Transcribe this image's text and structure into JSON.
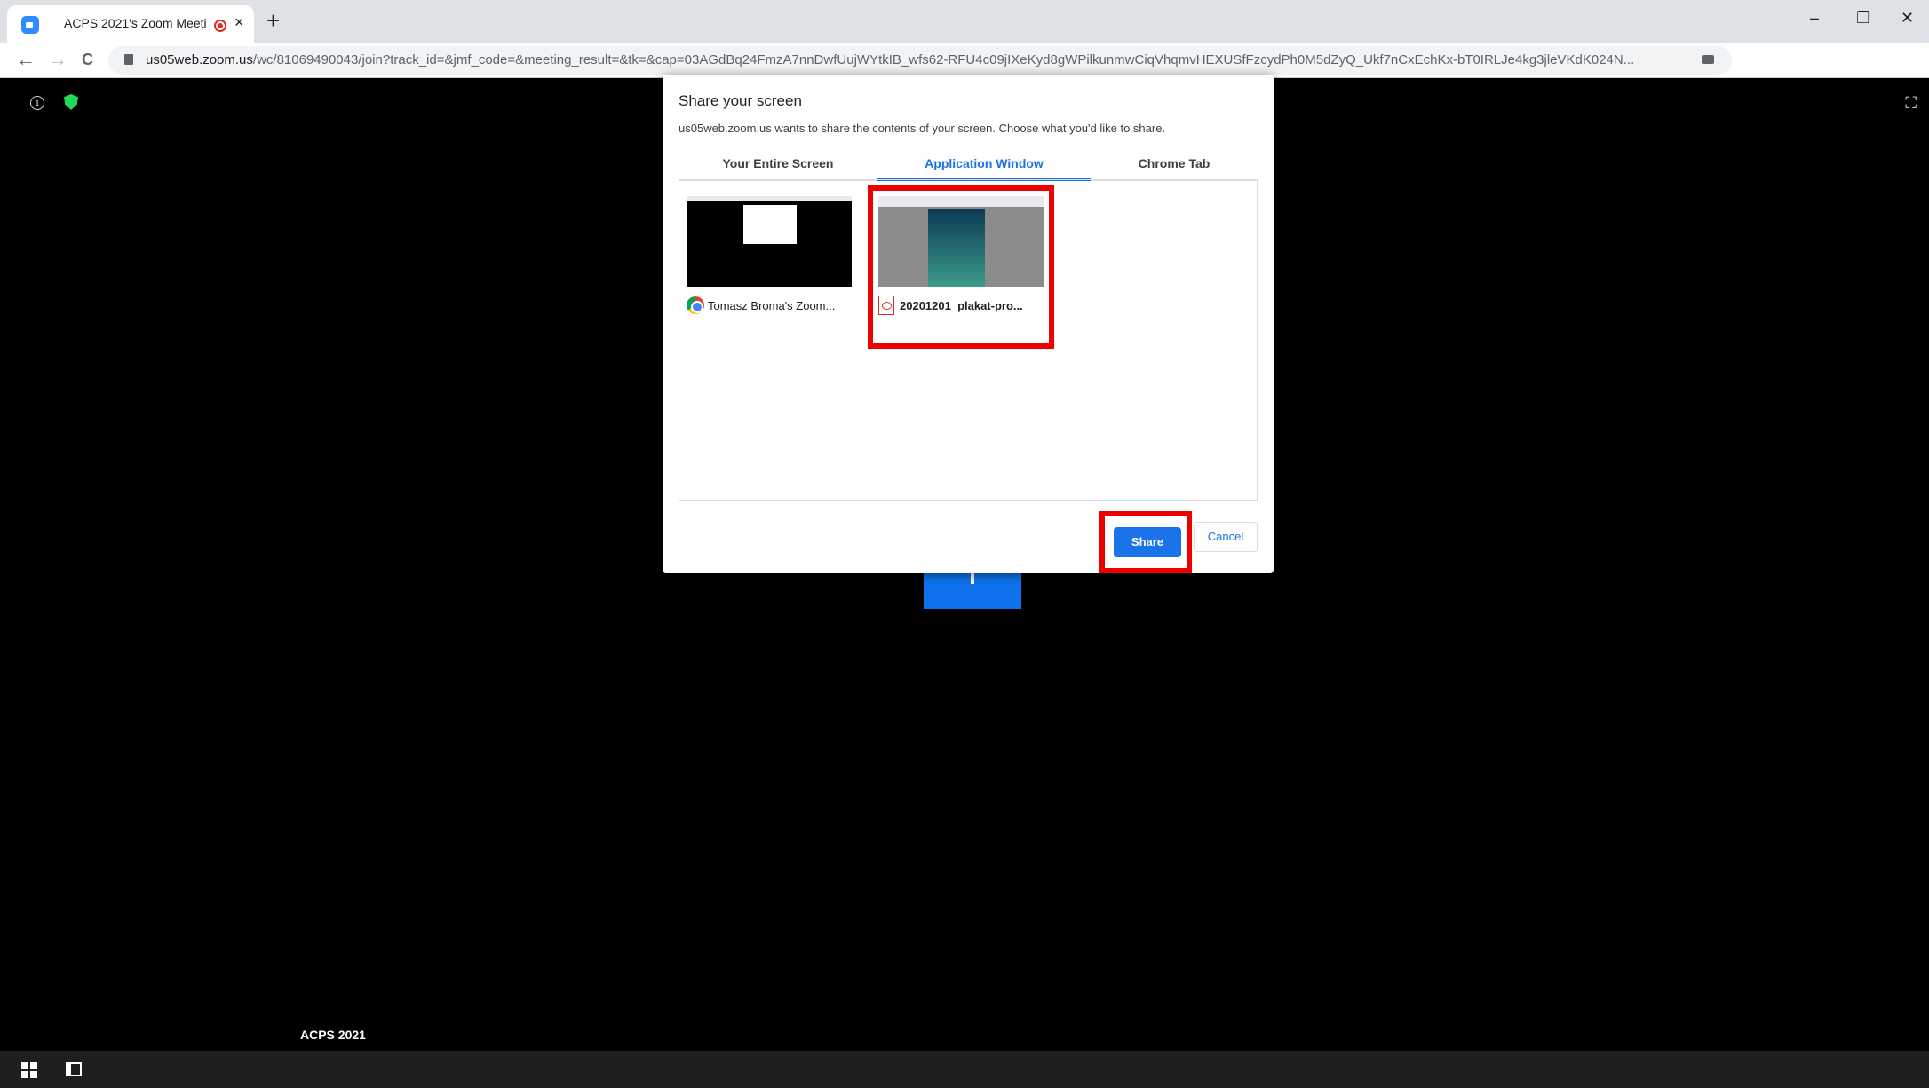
{
  "browser": {
    "tab_title": "ACPS 2021's Zoom Meeting",
    "tab_close": "×",
    "new_tab": "+",
    "window_controls": {
      "minimize": "–",
      "restore": "❐",
      "close": "✕"
    },
    "nav": {
      "back": "←",
      "forward": "→",
      "reload": "C"
    },
    "url_host": "us05web.zoom.us",
    "url_path": "/wc/81069490043/join?track_id=&jmf_code=&meeting_result=&tk=&cap=03AGdBq24FmzA7nnDwfUujWYtkIB_wfs62-RFU4c09jIXeKyd8gWPilkunmwCiqVhqmvHEXUSfFzcydPh0M5dZyQ_Ukf7nCxEchKx-bT0IRLJe4kg3jleVKdK024N...",
    "icons": [
      "zoom-favicon-icon",
      "recording-icon",
      "lock-icon",
      "camera-icon"
    ]
  },
  "meeting": {
    "info_icon": "i",
    "fullscreen_icon": "⛶",
    "name_label": "ACPS 2021"
  },
  "dialog": {
    "title": "Share your screen",
    "subtitle": "us05web.zoom.us wants to share the contents of your screen. Choose what you'd like to share.",
    "tabs": [
      {
        "label": "Your Entire Screen",
        "active": false
      },
      {
        "label": "Application Window",
        "active": true
      },
      {
        "label": "Chrome Tab",
        "active": false
      }
    ],
    "windows": [
      {
        "label": "Tomasz Broma's Zoom...",
        "icon": "chrome-icon",
        "selected": false
      },
      {
        "label": "20201201_plakat-pro...",
        "icon": "pdf-icon",
        "selected": true
      }
    ],
    "share_label": "Share",
    "cancel_label": "Cancel",
    "accent": "#1a73e8",
    "highlight": "#ee0000"
  },
  "taskbar": {
    "icons": [
      "windows-start-icon",
      "task-view-icon"
    ]
  }
}
